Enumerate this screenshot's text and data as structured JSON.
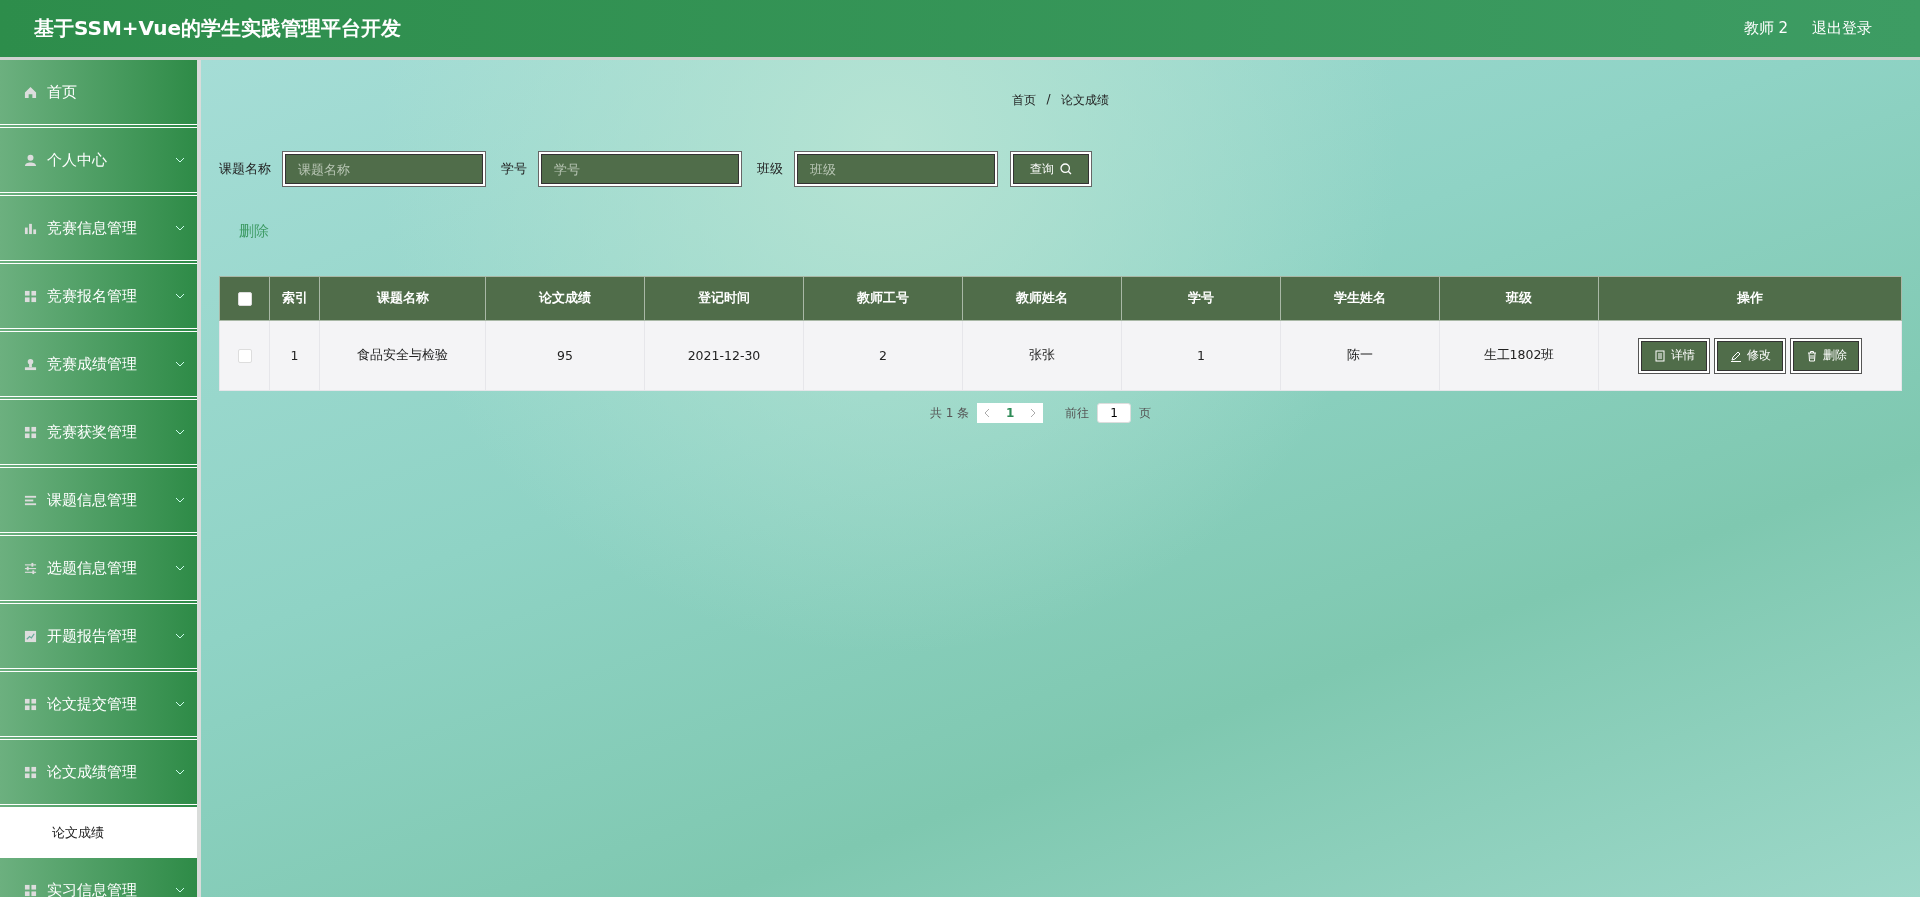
{
  "header": {
    "title": "基于SSM+Vue的学生实践管理平台开发",
    "user": "教师 2",
    "logout": "退出登录"
  },
  "sidebar": {
    "items": [
      {
        "label": "首页",
        "kind": "link"
      },
      {
        "label": "个人中心",
        "kind": "menu"
      },
      {
        "label": "竞赛信息管理",
        "kind": "menu"
      },
      {
        "label": "竞赛报名管理",
        "kind": "menu"
      },
      {
        "label": "竞赛成绩管理",
        "kind": "menu"
      },
      {
        "label": "竞赛获奖管理",
        "kind": "menu"
      },
      {
        "label": "课题信息管理",
        "kind": "menu"
      },
      {
        "label": "选题信息管理",
        "kind": "menu"
      },
      {
        "label": "开题报告管理",
        "kind": "menu"
      },
      {
        "label": "论文提交管理",
        "kind": "menu"
      },
      {
        "label": "论文成绩管理",
        "kind": "menu",
        "children": [
          {
            "label": "论文成绩",
            "selected": true
          }
        ]
      },
      {
        "label": "实习信息管理",
        "kind": "menu"
      }
    ]
  },
  "breadcrumb": {
    "items": [
      "首页",
      "论文成绩"
    ],
    "separator": "/"
  },
  "search": {
    "fields": [
      {
        "label": "课题名称",
        "placeholder": "课题名称"
      },
      {
        "label": "学号",
        "placeholder": "学号"
      },
      {
        "label": "班级",
        "placeholder": "班级"
      }
    ],
    "button": "查询"
  },
  "delete_link": "删除",
  "table": {
    "columns": [
      "索引",
      "课题名称",
      "论文成绩",
      "登记时间",
      "教师工号",
      "教师姓名",
      "学号",
      "学生姓名",
      "班级",
      "操作"
    ],
    "header_checked": false,
    "rows": [
      {
        "checked": false,
        "cells": [
          "1",
          "食品安全与检验",
          "95",
          "2021-12-30",
          "2",
          "张张",
          "1",
          "陈一",
          "生工1802班"
        ],
        "actions": [
          "详情",
          "修改",
          "删除"
        ]
      }
    ]
  },
  "pagination": {
    "total": "共 1 条",
    "pages": [
      {
        "label": "1",
        "selected": true
      }
    ],
    "goto": "前往",
    "page_input": "1",
    "page_unit": "页"
  }
}
